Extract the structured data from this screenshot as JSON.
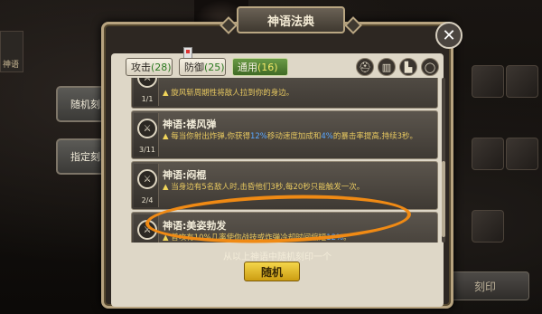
{
  "window": {
    "title": "神语法典"
  },
  "side_buttons": [
    {
      "label": "随机刻印"
    },
    {
      "label": "指定刻印"
    }
  ],
  "background": {
    "left_slot_label": "神语"
  },
  "tabs": [
    {
      "label": "攻击",
      "count": "(28)",
      "selected": false
    },
    {
      "label": "防御",
      "count": "(25)",
      "selected": false
    },
    {
      "label": "通用",
      "count": "(16)",
      "selected": true
    }
  ],
  "filter_icons": [
    "helmet-icon",
    "armor-icon",
    "boot-icon",
    "ring-icon"
  ],
  "entries": [
    {
      "level": "1/1",
      "name": "",
      "desc": "旋风斩周期性将敌人拉到你的身边。"
    },
    {
      "level": "3/11",
      "name": "神语:褛风弹",
      "desc_pre": "每当你射出炸弹,你获得",
      "desc_hl1": "12%",
      "desc_mid": "移动速度加成和",
      "desc_hl2": "4%",
      "desc_post": "的暴击率提高,持续3秒。"
    },
    {
      "level": "2/4",
      "name": "神语:闷棍",
      "desc": "当身边有5名敌人时,击昏他们3秒,每20秒只能触发一次。"
    },
    {
      "level": "3/",
      "name": "神语:美姿勃发",
      "desc_pre": "普攻有10%几率使你战技或炸弹冷却时间缩短",
      "desc_hl": "12%",
      "desc_post": "。"
    }
  ],
  "footer": {
    "note": "从以上神语中随机刻印一个",
    "random_button": "随机"
  },
  "bottom_right_button": "刻印",
  "colors": {
    "accent_orange": "#f08a14",
    "highlight_blue": "#5aa8ff",
    "desc_yellow": "#e7c860",
    "tab_selected_green": "#5a8a3c"
  }
}
